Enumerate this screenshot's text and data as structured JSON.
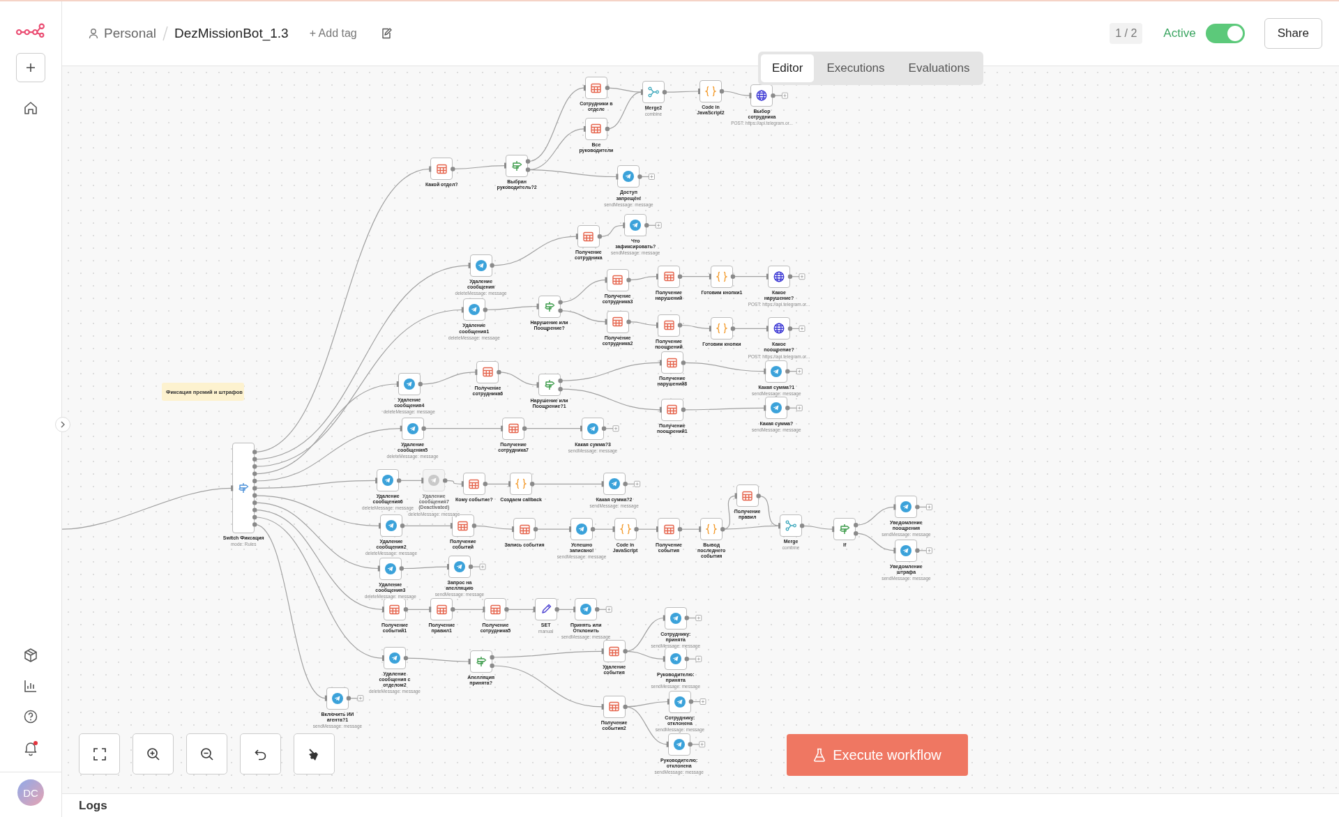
{
  "header": {
    "project": "Personal",
    "workflow_name": "DezMissionBot_1.3",
    "add_tag": "+ Add tag",
    "page_counter": "1 / 2",
    "active_label": "Active",
    "active": true,
    "share": "Share"
  },
  "view_tabs": [
    {
      "label": "Editor",
      "selected": true
    },
    {
      "label": "Executions",
      "selected": false
    },
    {
      "label": "Evaluations",
      "selected": false
    }
  ],
  "sidebar": {
    "notifications_unread": true,
    "user_initials": "DC"
  },
  "canvas": {
    "sticky_note": "Фиксация премий и штрафов",
    "nodes": [
      {
        "kind": "sheets",
        "label": "Сотрудники в отделе",
        "disabled": false
      },
      {
        "kind": "sheets",
        "label": "Все руководители",
        "disabled": false
      },
      {
        "kind": "merge",
        "label": "Merge2",
        "subtitle": "combine",
        "disabled": false
      },
      {
        "kind": "code",
        "label": "Code in JavaScript2",
        "disabled": false
      },
      {
        "kind": "http",
        "label": "Выбор сотрудника",
        "subtitle": "POST: https://api.telegram.or...",
        "disabled": false
      },
      {
        "kind": "sheets",
        "label": "Какой отдел?",
        "disabled": false
      },
      {
        "kind": "if",
        "label": "Выбран руководитель?2",
        "disabled": false
      },
      {
        "kind": "telegram",
        "label": "Доступ запрещён!",
        "subtitle": "sendMessage: message",
        "disabled": false
      },
      {
        "kind": "sheets",
        "label": "Получение сотрудника",
        "disabled": false
      },
      {
        "kind": "telegram",
        "label": "Что зафиксировать?",
        "subtitle": "sendMessage: message",
        "disabled": false
      },
      {
        "kind": "telegram",
        "label": "Удаление сообщения",
        "subtitle": "deleteMessage: message",
        "disabled": false
      },
      {
        "kind": "telegram",
        "label": "Удаление сообщения1",
        "subtitle": "deleteMessage: message",
        "disabled": false
      },
      {
        "kind": "if",
        "label": "Нарушение или Поощрение?",
        "disabled": false
      },
      {
        "kind": "sheets",
        "label": "Получение сотрудника3",
        "disabled": false
      },
      {
        "kind": "sheets",
        "label": "Получение нарушений",
        "disabled": false
      },
      {
        "kind": "code",
        "label": "Готовим кнопки1",
        "disabled": false
      },
      {
        "kind": "http",
        "label": "Какое нарушение?",
        "subtitle": "POST: https://api.telegram.or...",
        "disabled": false
      },
      {
        "kind": "sheets",
        "label": "Получение сотрудника2",
        "disabled": false
      },
      {
        "kind": "sheets",
        "label": "Получение поощрений",
        "disabled": false
      },
      {
        "kind": "code",
        "label": "Готовим кнопки",
        "disabled": false
      },
      {
        "kind": "http",
        "label": "Какое поощрение?",
        "subtitle": "POST: https://api.telegram.or...",
        "disabled": false
      },
      {
        "kind": "sheets",
        "label": "Получение нарушений8",
        "disabled": false
      },
      {
        "kind": "telegram",
        "label": "Какая сумма?1",
        "subtitle": "sendMessage: message",
        "disabled": false
      },
      {
        "kind": "telegram",
        "label": "Удаление сообщения4",
        "subtitle": "deleteMessage: message",
        "disabled": false
      },
      {
        "kind": "sheets",
        "label": "Получение сотрудника6",
        "disabled": false
      },
      {
        "kind": "if",
        "label": "Нарушение или Поощрение?1",
        "disabled": false
      },
      {
        "kind": "sheets",
        "label": "Получение поощрений1",
        "disabled": false
      },
      {
        "kind": "telegram",
        "label": "Какая сумма?",
        "subtitle": "sendMessage: message",
        "disabled": false
      },
      {
        "kind": "telegram",
        "label": "Удаление сообщения5",
        "subtitle": "deleteMessage: message",
        "disabled": false
      },
      {
        "kind": "sheets",
        "label": "Получение сотрудника7",
        "disabled": false
      },
      {
        "kind": "telegram",
        "label": "Какая сумма?3",
        "subtitle": "sendMessage: message",
        "disabled": false
      },
      {
        "kind": "switch",
        "label": "Switch Фиксация",
        "subtitle": "mode: Rules",
        "disabled": false
      },
      {
        "kind": "telegram",
        "label": "Удаление сообщения6",
        "subtitle": "deleteMessage: message",
        "disabled": false
      },
      {
        "kind": "telegram",
        "label": "Удаление сообщения7 (Deactivated)",
        "subtitle": "deleteMessage: message",
        "disabled": true
      },
      {
        "kind": "sheets",
        "label": "Кому событие?",
        "disabled": false
      },
      {
        "kind": "code",
        "label": "Создаем callback",
        "disabled": false
      },
      {
        "kind": "telegram",
        "label": "Какая сумма?2",
        "subtitle": "sendMessage: message",
        "disabled": false
      },
      {
        "kind": "telegram",
        "label": "Удаление сообщения2",
        "subtitle": "deleteMessage: message",
        "disabled": false
      },
      {
        "kind": "sheets",
        "label": "Получение событий",
        "disabled": false
      },
      {
        "kind": "sheets",
        "label": "Запись события",
        "disabled": false
      },
      {
        "kind": "telegram",
        "label": "Успешно записано!",
        "subtitle": "sendMessage: message",
        "disabled": false
      },
      {
        "kind": "code",
        "label": "Code in JavaScript",
        "disabled": false
      },
      {
        "kind": "sheets",
        "label": "Получение события",
        "disabled": false
      },
      {
        "kind": "code",
        "label": "Вывод последнего события",
        "disabled": false
      },
      {
        "kind": "sheets",
        "label": "Получение правил",
        "disabled": false
      },
      {
        "kind": "merge",
        "label": "Merge",
        "subtitle": "combine",
        "disabled": false
      },
      {
        "kind": "if",
        "label": "If",
        "disabled": false
      },
      {
        "kind": "telegram",
        "label": "Уведомление поощрения",
        "subtitle": "sendMessage: message",
        "disabled": false
      },
      {
        "kind": "telegram",
        "label": "Уведомление штрафа",
        "subtitle": "sendMessage: message",
        "disabled": false
      },
      {
        "kind": "telegram",
        "label": "Удаление сообщения3",
        "subtitle": "deleteMessage: message",
        "disabled": false
      },
      {
        "kind": "telegram",
        "label": "Запрос на апелляцию",
        "subtitle": "sendMessage: message",
        "disabled": false
      },
      {
        "kind": "sheets",
        "label": "Получение событий1",
        "disabled": false
      },
      {
        "kind": "sheets",
        "label": "Получение правил1",
        "disabled": false
      },
      {
        "kind": "sheets",
        "label": "Получение сотрудника5",
        "disabled": false
      },
      {
        "kind": "set",
        "label": "SET",
        "subtitle": "manual",
        "disabled": false
      },
      {
        "kind": "telegram",
        "label": "Принять или Отклонить",
        "subtitle": "sendMessage: message",
        "disabled": false
      },
      {
        "kind": "telegram",
        "label": "Удаление сообщения с отделом2",
        "subtitle": "deleteMessage: message",
        "disabled": false
      },
      {
        "kind": "if",
        "label": "Апелляция принята?",
        "disabled": false
      },
      {
        "kind": "sheets",
        "label": "Удаление события",
        "disabled": false
      },
      {
        "kind": "sheets",
        "label": "Получение события2",
        "disabled": false
      },
      {
        "kind": "telegram",
        "label": "Сотруднику: принята",
        "subtitle": "sendMessage: message",
        "disabled": false
      },
      {
        "kind": "telegram",
        "label": "Руководителю: принята",
        "subtitle": "sendMessage: message",
        "disabled": false
      },
      {
        "kind": "telegram",
        "label": "Сотруднику: отклонена",
        "subtitle": "sendMessage: message",
        "disabled": false
      },
      {
        "kind": "telegram",
        "label": "Руководителю: отклонена",
        "subtitle": "sendMessage: message",
        "disabled": false
      },
      {
        "kind": "telegram",
        "label": "Включить ИИ агента?1",
        "subtitle": "sendMessage: message",
        "disabled": false
      }
    ]
  },
  "execute_button": "Execute workflow",
  "logs_panel": {
    "title": "Logs"
  }
}
